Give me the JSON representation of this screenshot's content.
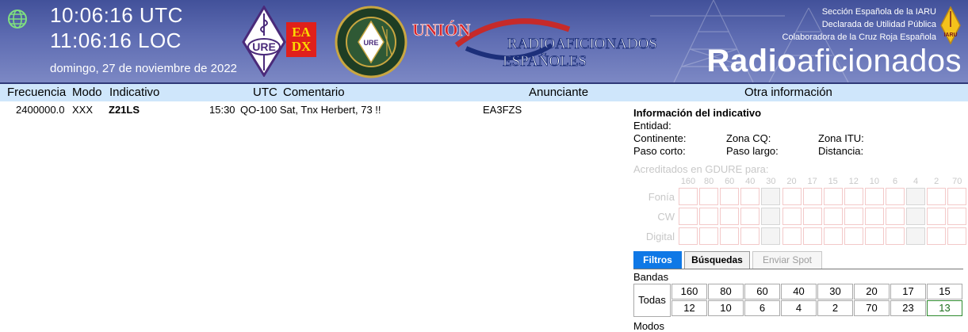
{
  "header": {
    "clock_utc": "10:06:16 UTC",
    "clock_loc": "11:06:16 LOC",
    "date": "domingo, 27 de noviembre de 2022",
    "logo_ure": "URE",
    "logo_eadx": [
      "EA",
      "DX"
    ],
    "logo_union": [
      "UNIÓN",
      "RADIOAFICIONADOS",
      "ESPAÑOLES"
    ],
    "iaru_lines": [
      "Sección Española de la IARU",
      "Declarada de Utilidad Pública",
      "Colaboradora de la Cruz Roja Española"
    ],
    "iaru_logo": "IARU",
    "brand_bold": "Radio",
    "brand_light": "aficionados",
    "colors": {
      "banner": "#4b5aa4",
      "eadx_bg": "#e0201b",
      "eadx_text": "#fcd900"
    }
  },
  "table": {
    "columns": [
      "Frecuencia",
      "Modo",
      "Indicativo",
      "UTC",
      "Comentario",
      "Anunciante",
      "Otra información"
    ],
    "rows": [
      {
        "freq": "2400000.0",
        "mode": "XXX",
        "call": "Z21LS",
        "utc": "15:30",
        "comment": "QO-100 Sat, Tnx Herbert, 73 !!",
        "spotter": "EA3FZS"
      }
    ]
  },
  "info": {
    "title": "Información del indicativo",
    "entidad": "Entidad:",
    "continente": "Continente:",
    "zona_cq": "Zona CQ:",
    "zona_itu": "Zona ITU:",
    "paso_corto": "Paso corto:",
    "paso_largo": "Paso largo:",
    "distancia": "Distancia:"
  },
  "gdure": {
    "title": "Acreditados en GDURE para:",
    "bands": [
      "160",
      "80",
      "60",
      "40",
      "30",
      "20",
      "17",
      "15",
      "12",
      "10",
      "6",
      "4",
      "2",
      "70"
    ],
    "modes": [
      "Fonía",
      "CW",
      "Digital"
    ]
  },
  "tabs": [
    {
      "label": "Filtros",
      "state": "active"
    },
    {
      "label": "Búsquedas",
      "state": "normal"
    },
    {
      "label": "Enviar Spot",
      "state": "disabled"
    }
  ],
  "filters": {
    "bandas_label": "Bandas",
    "todas_label": "Todas",
    "row1": [
      "160",
      "80",
      "60",
      "40",
      "30",
      "20",
      "17",
      "15"
    ],
    "row2": [
      "12",
      "10",
      "6",
      "4",
      "2",
      "70",
      "23",
      "13"
    ],
    "selected": "13",
    "modos_label": "Modos"
  }
}
